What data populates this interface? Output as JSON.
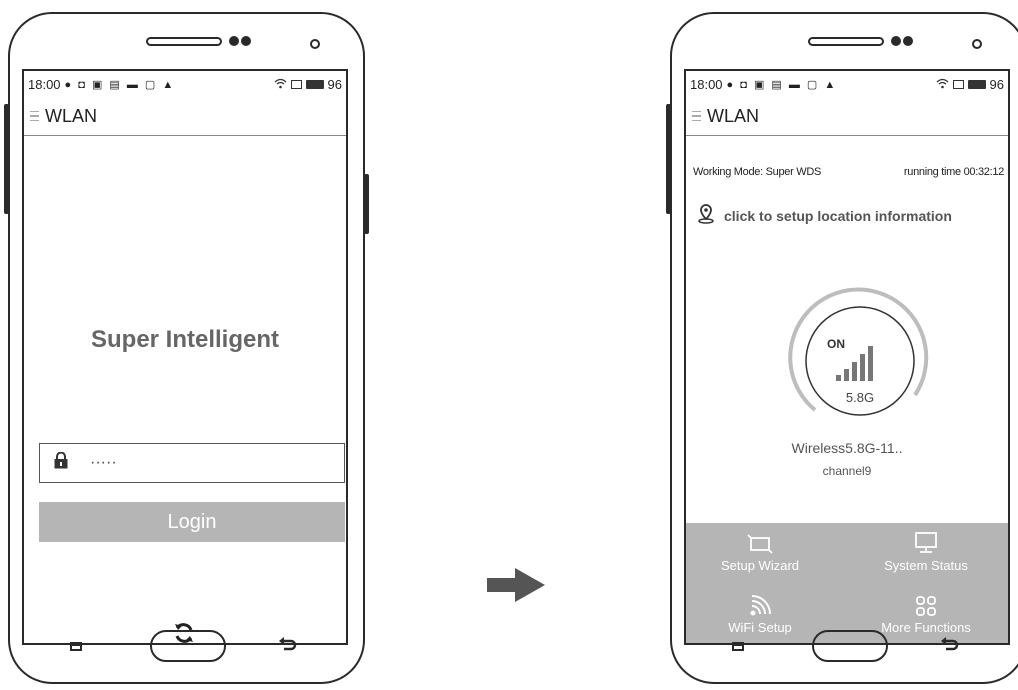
{
  "status_bar": {
    "time": "18:00",
    "icons": "● ◘ ▣ ▤ ▬ ▢ ▲",
    "battery": "96",
    "wifi_icon": "wifi-icon"
  },
  "appbar": {
    "title": "WLAN"
  },
  "login_screen": {
    "headline": "Super Intelligent",
    "password_value": "·····",
    "login_label": "Login"
  },
  "status_screen": {
    "working_mode": "Working Mode: Super WDS",
    "running_time": "running time 00:32:12",
    "location_prompt": "click to setup location information",
    "power_state": "ON",
    "band": "5.8G",
    "ssid": "Wireless5.8G-11..",
    "channel": "channel9",
    "functions": [
      {
        "label": "Setup Wizard",
        "icon": "setup-wizard-icon"
      },
      {
        "label": "System Status",
        "icon": "monitor-icon"
      },
      {
        "label": "WiFi Setup",
        "icon": "wifi-signal-icon"
      },
      {
        "label": "More Functions",
        "icon": "grid-icon"
      }
    ]
  },
  "colors": {
    "accent_gray": "#b5b5b5",
    "outline": "#2a2a2a"
  }
}
